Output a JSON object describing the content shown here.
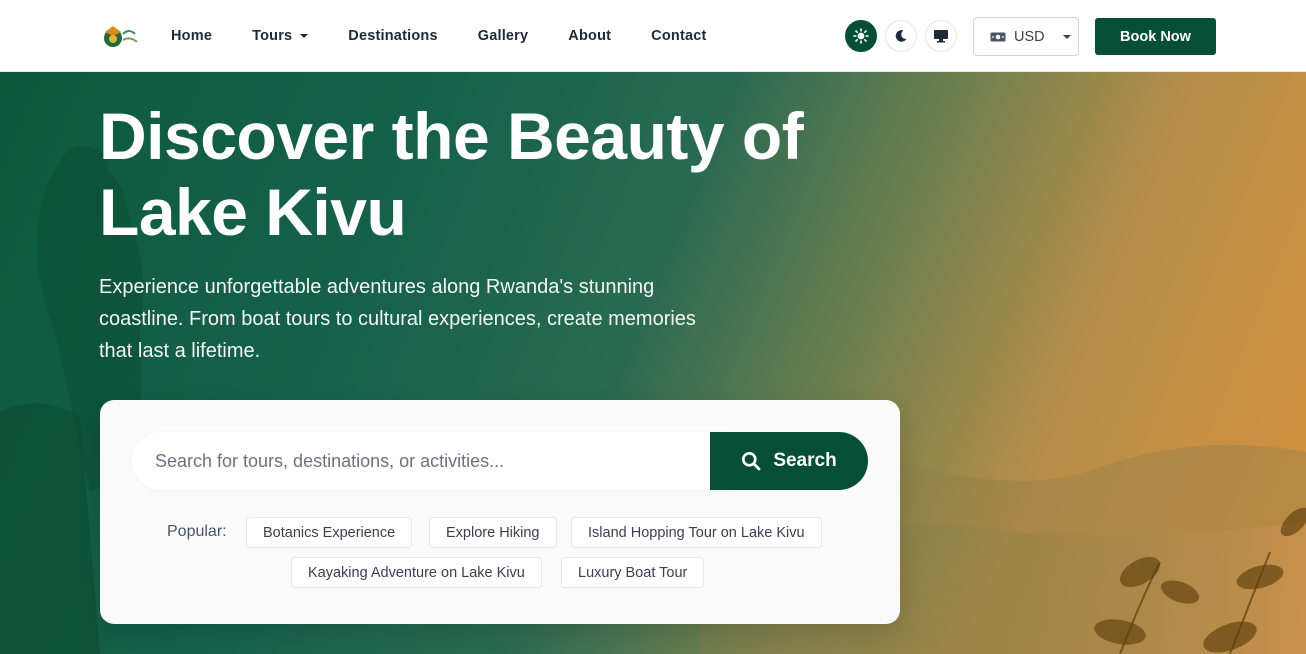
{
  "nav": {
    "links": [
      "Home",
      "Tours",
      "Destinations",
      "Gallery",
      "About",
      "Contact"
    ],
    "currency": "USD",
    "book_label": "Book Now"
  },
  "hero": {
    "title": "Discover the Beauty of Lake Kivu",
    "subtitle": "Experience unforgettable adventures along Rwanda's stunning coastline. From boat tours to cultural experiences, create memories that last a lifetime."
  },
  "search": {
    "placeholder": "Search for tours, destinations, or activities...",
    "button_label": "Search",
    "popular_label": "Popular:",
    "popular": [
      "Botanics Experience",
      "Explore Hiking",
      "Island Hopping Tour on Lake Kivu",
      "Kayaking Adventure on Lake Kivu",
      "Luxury Boat Tour"
    ]
  },
  "colors": {
    "brand_green": "#064e36",
    "hero_orange": "#d8923e"
  },
  "icons": [
    "logo-icon",
    "sun-icon",
    "moon-icon",
    "monitor-icon",
    "money-icon",
    "search-icon"
  ]
}
